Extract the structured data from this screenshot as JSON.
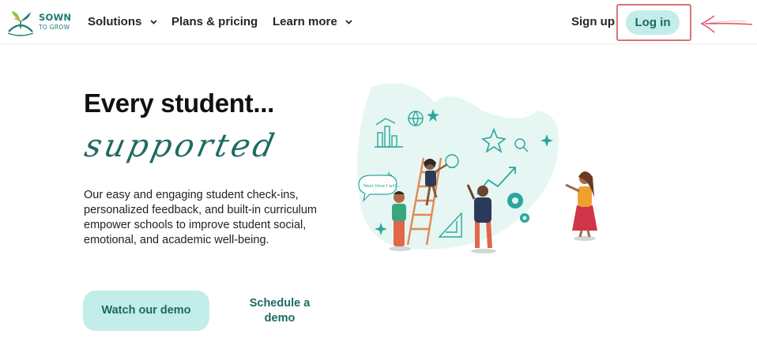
{
  "brand": {
    "line1": "SOWN",
    "line2": "TO GROW",
    "color": "#1f7d74"
  },
  "nav": {
    "items": [
      {
        "label": "Solutions",
        "dropdown": true
      },
      {
        "label": "Plans & pricing",
        "dropdown": false
      },
      {
        "label": "Learn more",
        "dropdown": true
      }
    ],
    "signup_label": "Sign up",
    "login_label": "Log in"
  },
  "hero": {
    "headline": "Every student...",
    "script_word": "supported",
    "description": "Our easy and engaging student check-ins, personalized feedback, and built-in curriculum empower schools to improve student social, emotional, and academic well-being.",
    "buttons": {
      "watch_demo": "Watch our demo",
      "schedule_demo": "Schedule a demo"
    }
  },
  "illustration": {
    "bubble_text": "Next time I will...",
    "icons": [
      "bar-chart-icon",
      "globe-icon",
      "star-icon",
      "magnifier-icon",
      "gear-icon",
      "lightbulb-icon",
      "triangle-ruler-icon",
      "trend-arrow-icon"
    ]
  },
  "colors": {
    "accent": "#c3ede8",
    "accent_text": "#1b6963",
    "highlight_frame": "#d9747a",
    "annotation_arrow": "#e0586a"
  }
}
